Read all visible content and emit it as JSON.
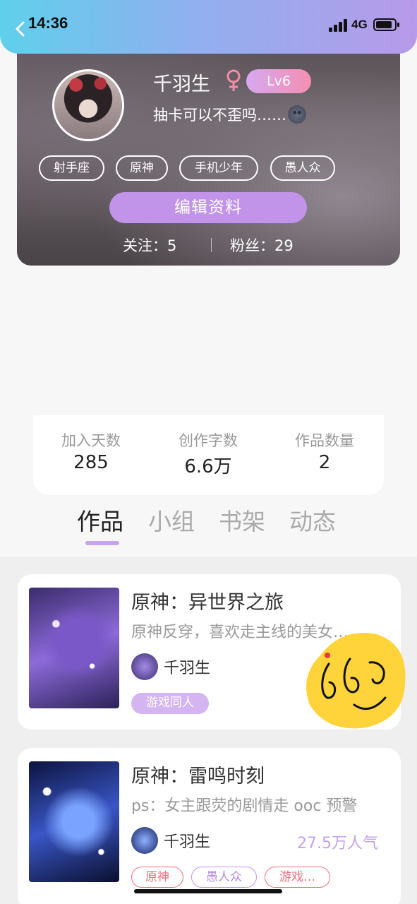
{
  "status_bar": {
    "time": "14:36",
    "network": "4G"
  },
  "profile": {
    "username": "千羽生",
    "level": "Lv6",
    "signature": "抽卡可以不歪吗……",
    "tags": [
      "射手座",
      "原神",
      "手机少年",
      "愚人众"
    ],
    "edit_button": "编辑资料",
    "following_label": "关注：5",
    "followers_label": "粉丝：29"
  },
  "stats": [
    {
      "label": "加入天数",
      "value": "285"
    },
    {
      "label": "创作字数",
      "value": "6.6万"
    },
    {
      "label": "作品数量",
      "value": "2"
    }
  ],
  "tabs": [
    "作品",
    "小组",
    "书架",
    "动态"
  ],
  "works": [
    {
      "title": "原神：异世界之旅",
      "desc": "原神反穿，喜欢走主线的美女…",
      "author": "千羽生",
      "popularity": "",
      "chips": [
        "游戏同人"
      ]
    },
    {
      "title": "原神：雷鸣时刻",
      "desc": "ps：女主跟荧的剧情走 ooc 预警",
      "author": "千羽生",
      "popularity": "27.5万人气",
      "chips": [
        "原神",
        "愚人众",
        "游戏…"
      ]
    }
  ],
  "colors": {
    "accent": "#c193e9",
    "header_start": "#5fd0ec",
    "header_end": "#b79ae9"
  }
}
